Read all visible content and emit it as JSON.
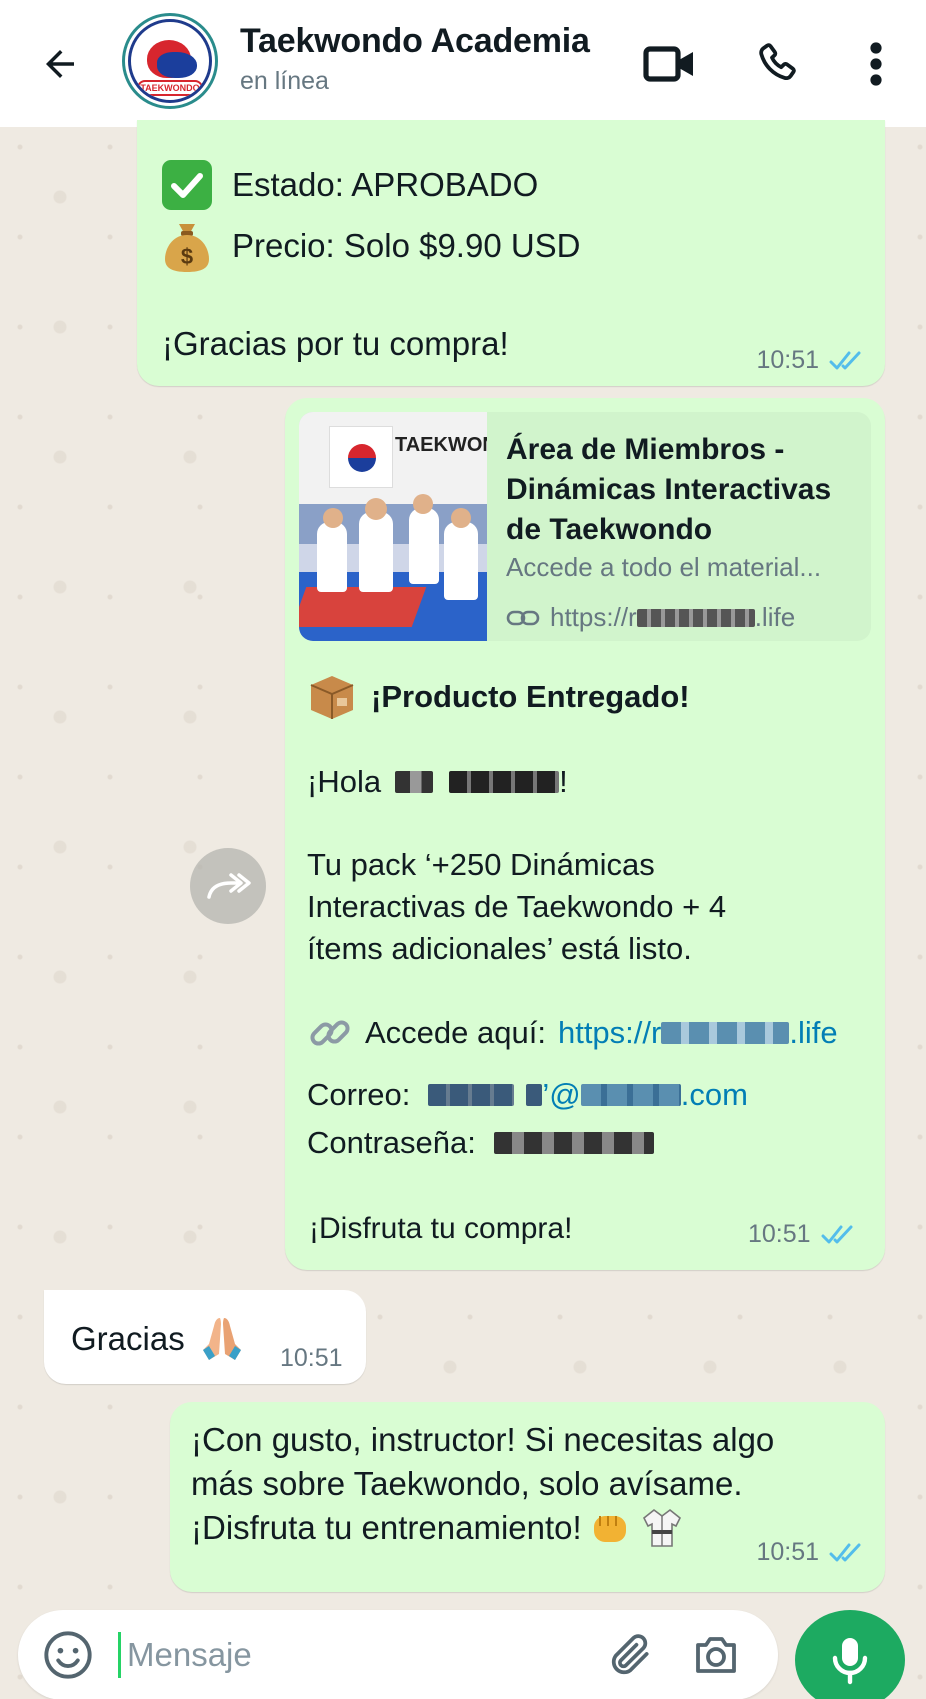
{
  "header": {
    "title": "Taekwondo Academia",
    "status": "en línea",
    "avatar_text": "TAEKWONDO"
  },
  "messages": {
    "m1": {
      "status_line": "Estado: APROBADO",
      "price_line": "Precio: Solo $9.90 USD",
      "thanks": "¡Gracias por tu compra!",
      "time": "10:51"
    },
    "m2": {
      "link_title": "Área de Miembros - Dinámicas Interactivas de Taekwondo",
      "link_desc": "Accede a todo el material...",
      "link_url_prefix": "https://r",
      "link_url_suffix": ".life",
      "thumb_banner": "TAEKWONDO",
      "heading": "¡Producto Entregado!",
      "greeting_prefix": "¡Hola",
      "greeting_suffix": "!",
      "body_l1": "Tu pack  ‘+250 Dinámicas",
      "body_l2": "Interactivas de Taekwondo + 4",
      "body_l3": "ítems adicionales’ está listo.",
      "access_label": "Accede aquí:",
      "access_url_prefix": "https://r",
      "access_url_suffix": ".life",
      "email_label": "Correo:",
      "email_at": "’@",
      "email_suffix": ".com",
      "password_label": "Contraseña:",
      "enjoy": "¡Disfruta tu compra!",
      "time": "10:51"
    },
    "m3": {
      "text": "Gracias",
      "time": "10:51"
    },
    "m4": {
      "l1": "¡Con gusto, instructor! Si necesitas algo",
      "l2": "más sobre Taekwondo, solo avísame.",
      "l3": "¡Disfruta tu entrenamiento!",
      "time": "10:51"
    }
  },
  "composer": {
    "placeholder": "Mensaje"
  },
  "colors": {
    "outgoing_bubble": "#d9fdd3",
    "incoming_bubble": "#ffffff",
    "read_ticks": "#53bdeb",
    "accent_green": "#1daa61",
    "link_blue": "#027eb5"
  }
}
